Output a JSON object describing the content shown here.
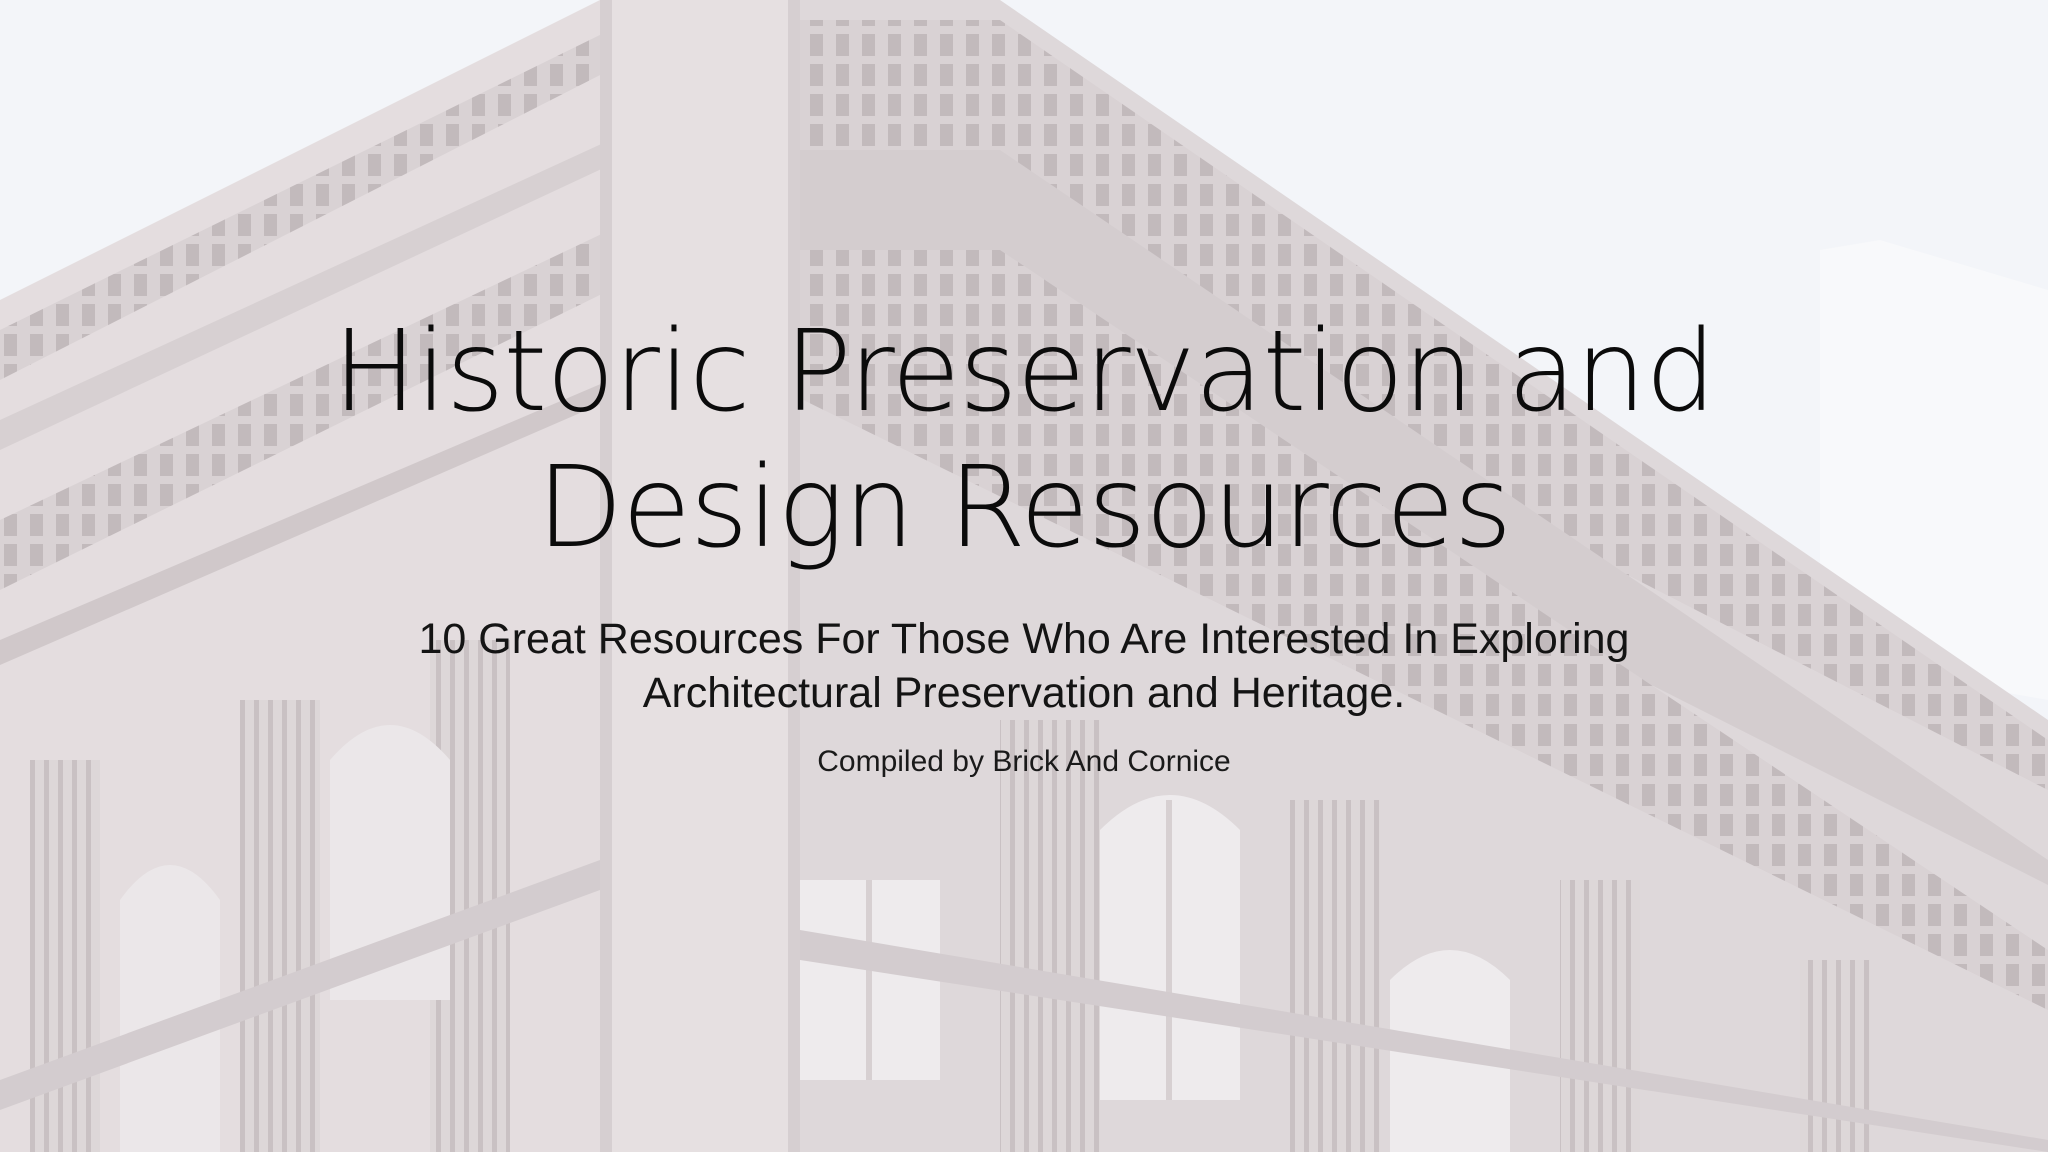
{
  "slide": {
    "title_line1": "Historic Preservation and",
    "title_line2": "Design Resources",
    "subtitle_line1": "10 Great Resources For Those Who Are Interested In Exploring",
    "subtitle_line2": "Architectural Preservation and Heritage.",
    "credit": "Compiled by Brick And Cornice"
  },
  "colors": {
    "background": "#eef1f6",
    "stone": "#b9aeb0",
    "text": "#0b0b0b"
  }
}
